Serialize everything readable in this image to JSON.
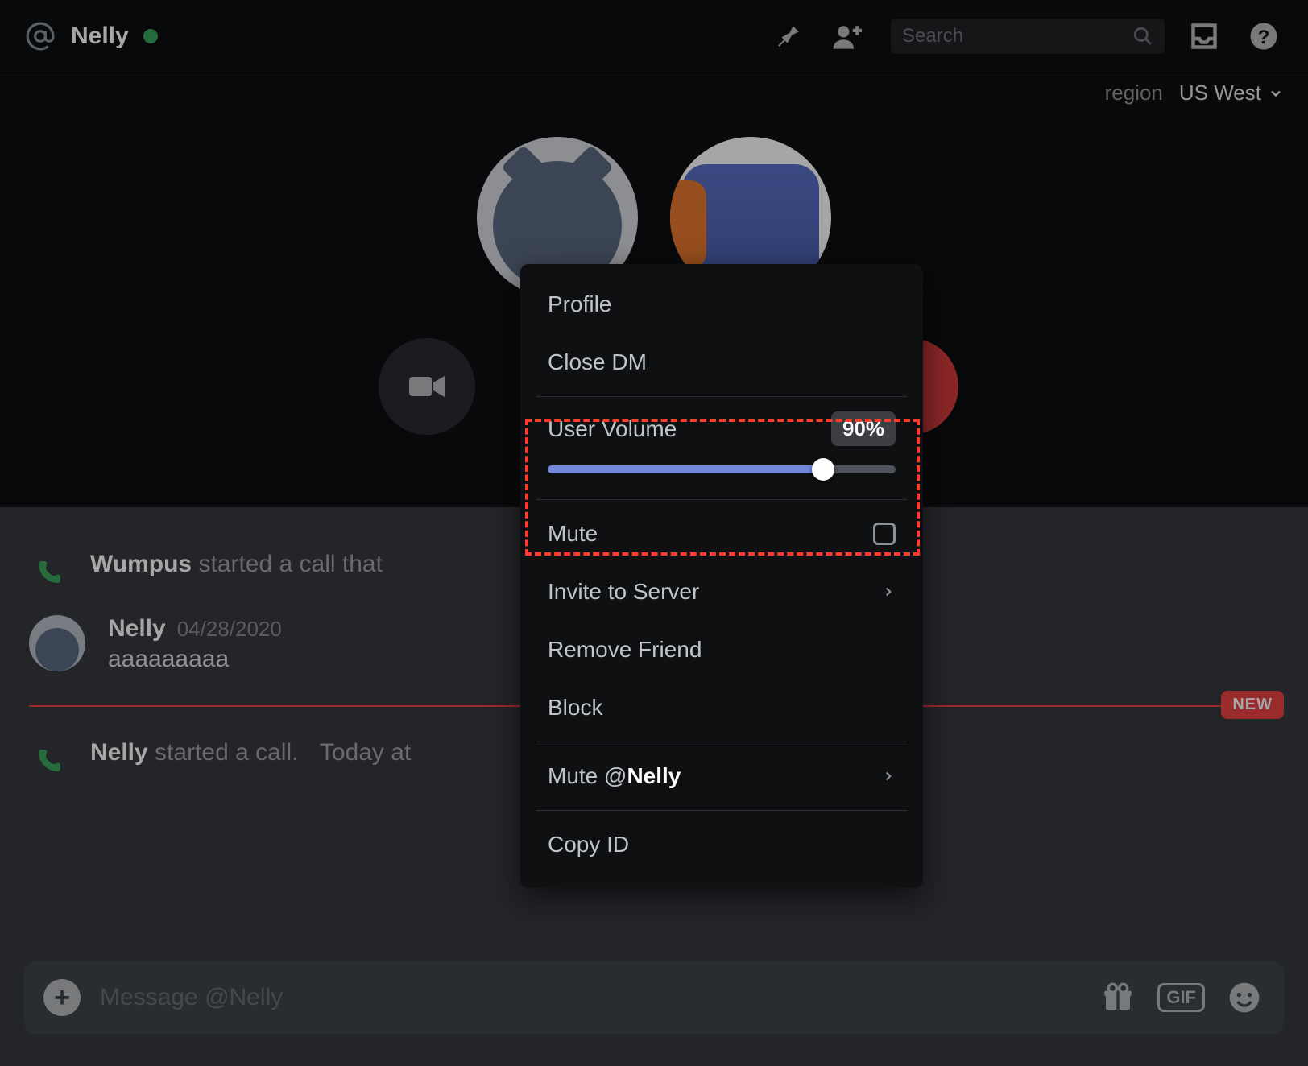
{
  "header": {
    "channel_name": "Nelly",
    "search_placeholder": "Search"
  },
  "region": {
    "label": "region",
    "value": "US West"
  },
  "messages": {
    "call1_author": "Wumpus",
    "call1_rest": " started a call that",
    "msg_author": "Nelly",
    "msg_timestamp": "04/28/2020",
    "msg_text": "aaaaaaaaa",
    "new_label": "NEW",
    "call2_author": "Nelly",
    "call2_rest": " started a call.",
    "call2_time": "Today at"
  },
  "composer": {
    "placeholder": "Message @Nelly",
    "gif_label": "GIF"
  },
  "context_menu": {
    "profile": "Profile",
    "close_dm": "Close DM",
    "user_volume_label": "User Volume",
    "user_volume_value": "90%",
    "user_volume_percent": 90,
    "mute": "Mute",
    "invite_to_server": "Invite to Server",
    "remove_friend": "Remove Friend",
    "block": "Block",
    "mute_at_prefix": "Mute @",
    "mute_at_name": "Nelly",
    "copy_id": "Copy ID"
  }
}
